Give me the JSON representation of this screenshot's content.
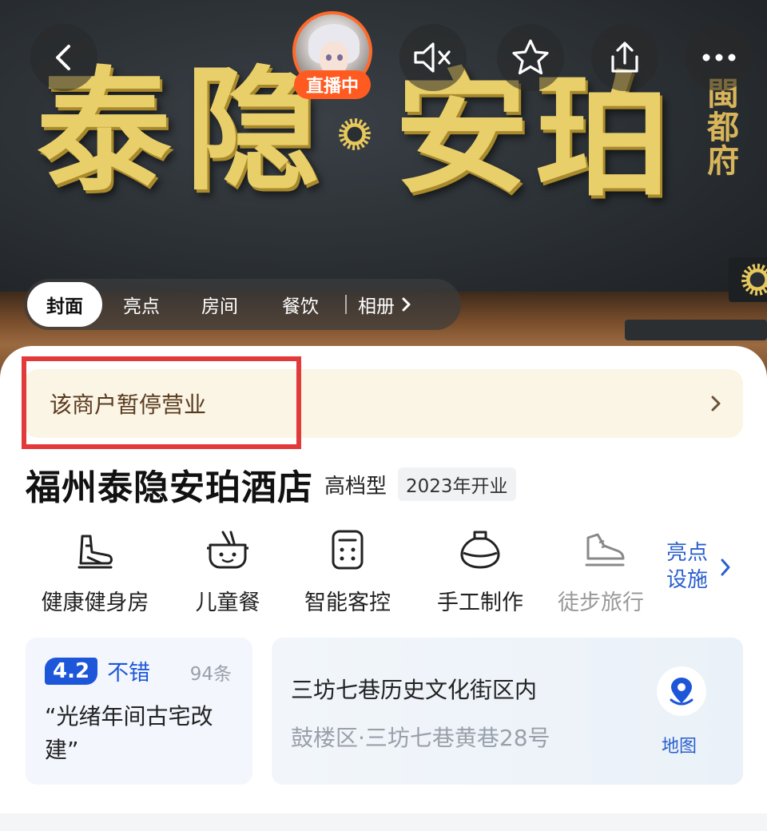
{
  "hero": {
    "sign_chars": [
      "泰",
      "隐",
      "安",
      "珀"
    ],
    "side_text": "閩都府",
    "live_badge": "直播中",
    "icons": {
      "back": "chevron-left-icon",
      "mute": "volume-mute-icon",
      "favorite": "star-icon",
      "share": "share-icon",
      "more": "more-dots-icon"
    }
  },
  "tabs": {
    "items": [
      "封面",
      "亮点",
      "房间",
      "餐饮"
    ],
    "album_label": "相册",
    "active": "封面"
  },
  "notice": {
    "text": "该商户暂停营业"
  },
  "hotel": {
    "name": "福州泰隐安珀酒店",
    "type": "高档型",
    "opened": "2023年开业"
  },
  "facilities": {
    "items": [
      {
        "label": "健康健身房",
        "icon": "gym-icon"
      },
      {
        "label": "儿童餐",
        "icon": "kids-meal-icon"
      },
      {
        "label": "智能客控",
        "icon": "smart-control-icon"
      },
      {
        "label": "手工制作",
        "icon": "handcraft-icon"
      },
      {
        "label": "徒步旅行",
        "icon": "hiking-shoe-icon"
      }
    ],
    "more_label_line1": "亮点",
    "more_label_line2": "设施"
  },
  "rating": {
    "score": "4.2",
    "word": "不错",
    "count": "94条",
    "quote": "“光绪年间古宅改建”"
  },
  "address": {
    "main": "三坊七巷历史文化街区内",
    "detail": "鼓楼区·三坊七巷黄巷28号",
    "map_label": "地图"
  },
  "colors": {
    "accent_blue": "#1d56d8",
    "live_orange": "#ff5a1f",
    "notice_bg": "#fbf5e6",
    "highlight_red": "#e23a3a",
    "sign_gold": "#e9cf6a"
  }
}
